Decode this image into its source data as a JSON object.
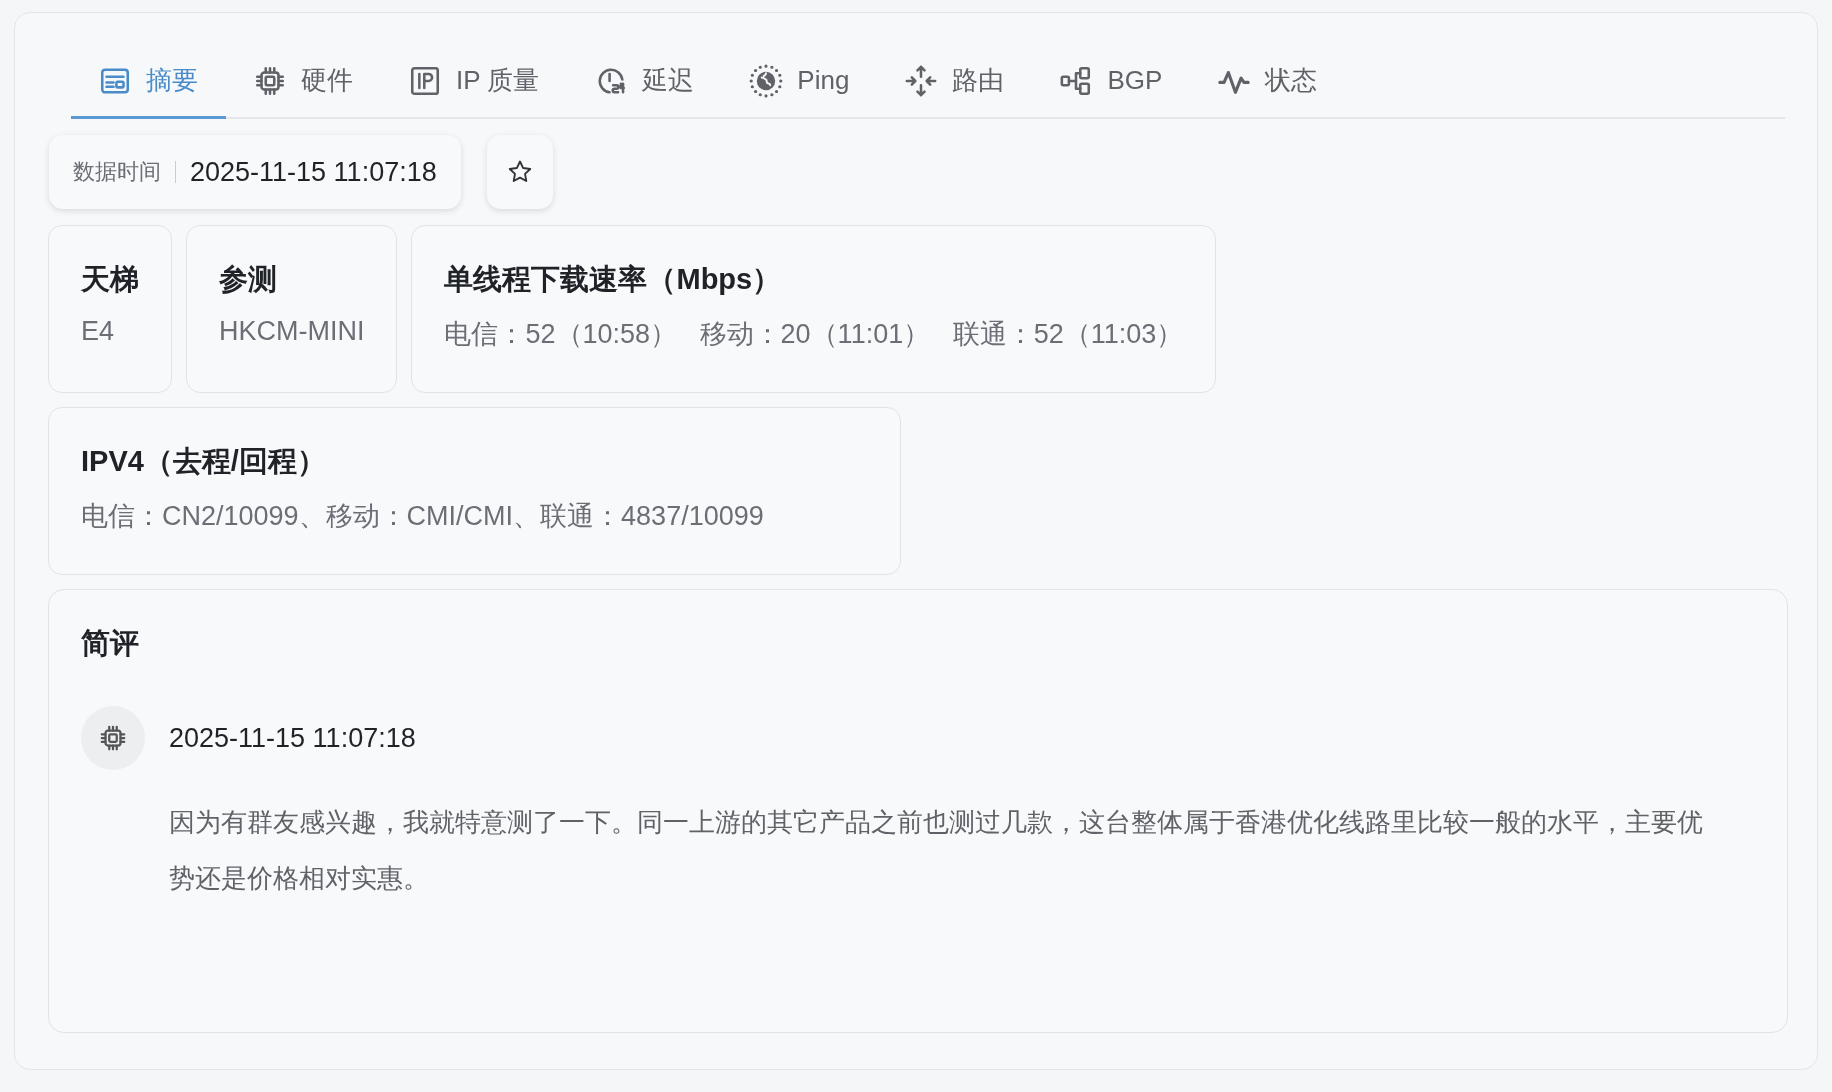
{
  "tabs": [
    {
      "label": "摘要",
      "selected": true
    },
    {
      "label": "硬件",
      "selected": false
    },
    {
      "label": "IP 质量",
      "selected": false
    },
    {
      "label": "延迟",
      "selected": false
    },
    {
      "label": "Ping",
      "selected": false
    },
    {
      "label": "路由",
      "selected": false
    },
    {
      "label": "BGP",
      "selected": false
    },
    {
      "label": "状态",
      "selected": false
    }
  ],
  "data_time": {
    "label": "数据时间",
    "value": "2025-11-15 11:07:18"
  },
  "cards": [
    {
      "title": "天梯",
      "value": "E4"
    },
    {
      "title": "参测",
      "value": "HKCM-MINI"
    },
    {
      "title": "单线程下载速率（Mbps）",
      "value": "电信：52（10:58）   移动：20（11:01）   联通：52（11:03）"
    },
    {
      "title": "IPV4（去程/回程）",
      "value": "电信：CN2/10099、移动：CMI/CMI、联通：4837/10099"
    }
  ],
  "review": {
    "title": "简评",
    "time": "2025-11-15 11:07:18",
    "text": "因为有群友感兴趣，我就特意测了一下。同一上游的其它产品之前也测过几款，这台整体属于香港优化线路里比较一般的水平，主要优势还是价格相对实惠。"
  }
}
